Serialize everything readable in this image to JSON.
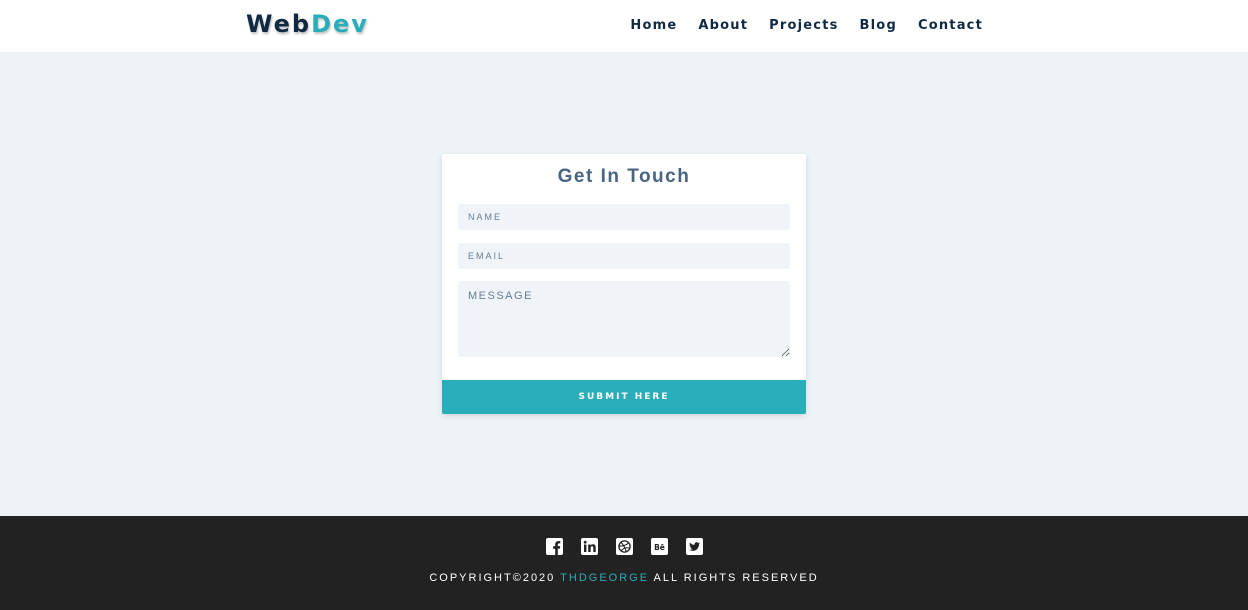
{
  "header": {
    "logo_part1": "Web",
    "logo_part2": "Dev",
    "nav": [
      "Home",
      "About",
      "Projects",
      "Blog",
      "Contact"
    ]
  },
  "contact": {
    "title": "Get In Touch",
    "name_placeholder": "NAME",
    "email_placeholder": "EMAIL",
    "message_placeholder": "MESSAGE",
    "submit_label": "SUBMIT HERE"
  },
  "footer": {
    "socials": [
      "facebook-icon",
      "linkedin-icon",
      "dribbble-icon",
      "behance-icon",
      "twitter-icon"
    ],
    "copyright_prefix": "COPYRIGHT©2020",
    "author": "THDGEORGE",
    "copyright_suffix": "ALL RIGHTS RESERVED"
  },
  "colors": {
    "accent": "#2aadba",
    "navy": "#102a43",
    "page_bg": "#edf3f6",
    "footer_bg": "#222222"
  }
}
